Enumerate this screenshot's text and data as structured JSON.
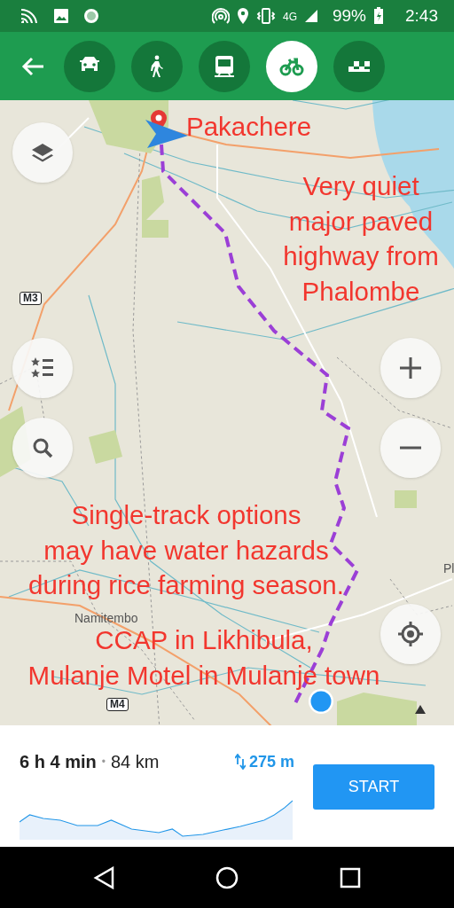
{
  "status_bar": {
    "network": "4G",
    "battery": "99%",
    "time": "2:43"
  },
  "transport_modes": [
    {
      "kind": "car",
      "selected": false
    },
    {
      "kind": "walk",
      "selected": false
    },
    {
      "kind": "train",
      "selected": false
    },
    {
      "kind": "bike",
      "selected": true
    },
    {
      "kind": "taxi",
      "selected": false
    }
  ],
  "map": {
    "place_labels": [
      "Namitembo",
      "Pl"
    ],
    "road_shields": [
      "M3",
      "M4"
    ],
    "annotations": [
      "Pakachere",
      "Very quiet\nmajor paved\nhighway from\nPhalombe",
      "Single-track options\nmay have water hazards\nduring rice farming season.",
      "CCAP in Likhibula,\nMulanje Motel in Mulanje town"
    ]
  },
  "route_summary": {
    "duration": "6 h 4 min",
    "separator": "•",
    "distance": "84 km",
    "elevation_gain": "275 m",
    "start_button": "START"
  }
}
